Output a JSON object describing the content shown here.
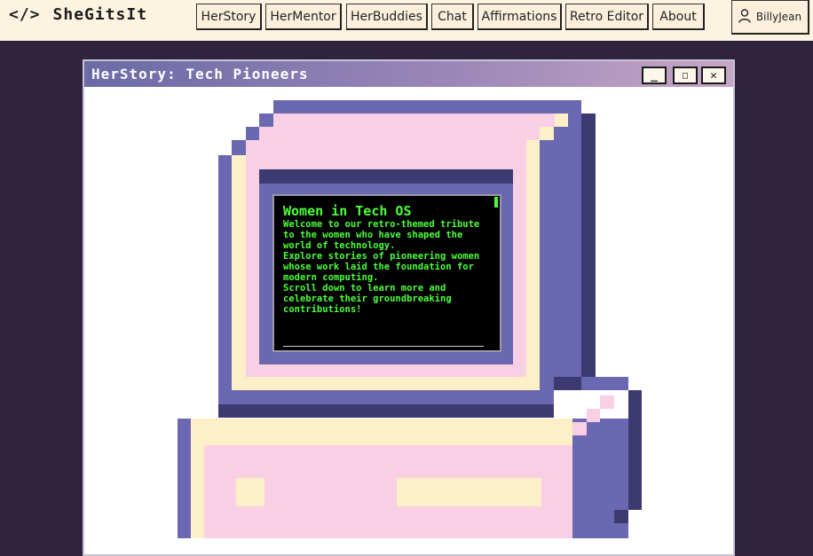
{
  "brand": {
    "logo_icon": "</>",
    "name": "SheGitsIt"
  },
  "nav": [
    {
      "label": "HerStory"
    },
    {
      "label": "HerMentor"
    },
    {
      "label": "HerBuddies"
    },
    {
      "label": "Chat"
    },
    {
      "label": "Affirmations"
    },
    {
      "label": "Retro Editor"
    },
    {
      "label": "About"
    }
  ],
  "user": {
    "icon": "user-icon",
    "name": "BillyJean"
  },
  "window": {
    "title": "HerStory: Tech Pioneers",
    "controls": {
      "minimize": "_",
      "maximize": "□",
      "close": "✕"
    }
  },
  "screen": {
    "title": "Women in Tech OS",
    "paragraphs": [
      "Welcome to our retro-themed tribute to the women who have shaped the world of technology.",
      "Explore stories of pioneering women whose work laid the foundation for modern computing.",
      "Scroll down to learn more and celebrate their groundbreaking contributions!"
    ]
  },
  "colors": {
    "page_bg": "#2e2440",
    "topbar_bg": "#fdf3e1",
    "pc_purple": "#6a68b0",
    "pc_dark": "#3d3a72",
    "pc_pink": "#f8cfe3",
    "pc_cream": "#fdf0c8",
    "terminal_green": "#4cff3a"
  }
}
